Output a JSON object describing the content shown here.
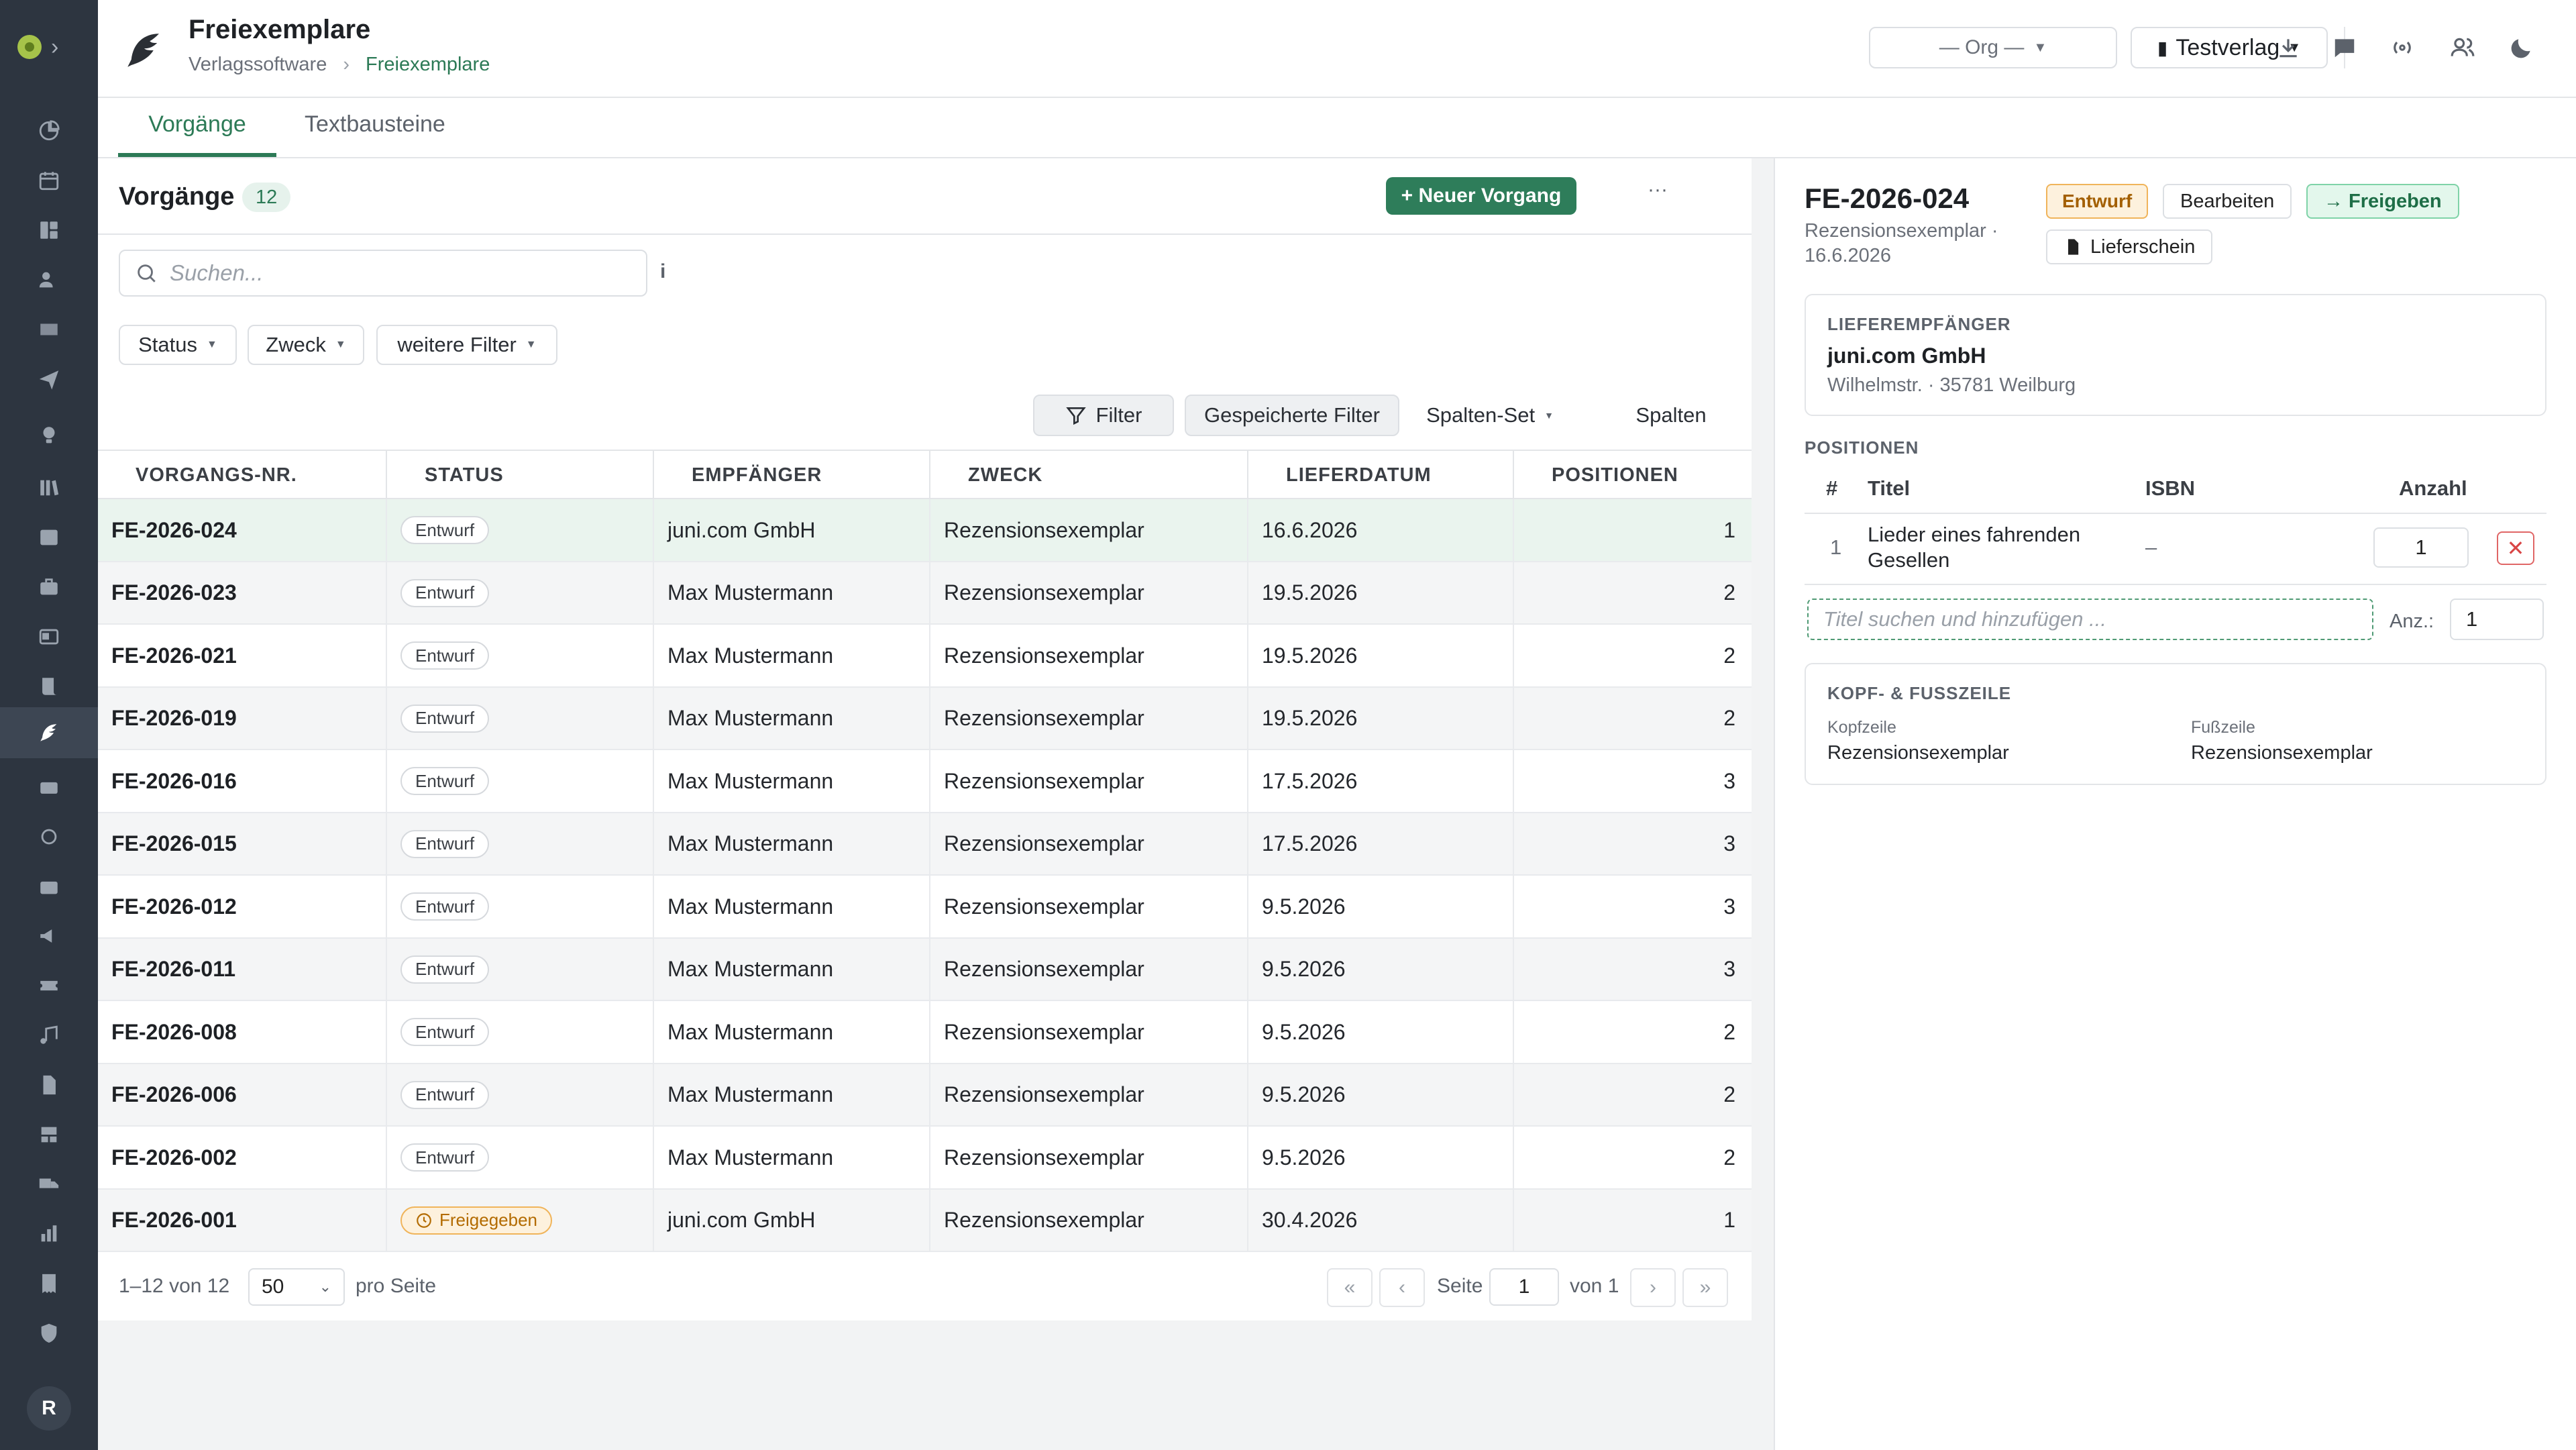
{
  "header": {
    "title": "Freiexemplare",
    "breadcrumb": [
      "Verlagssoftware",
      "Freiexemplare"
    ],
    "org_select": "— Org —",
    "verlag_select": "Testverlag"
  },
  "tabs": [
    {
      "label": "Vorgänge",
      "active": true
    },
    {
      "label": "Textbausteine",
      "active": false
    }
  ],
  "list": {
    "title": "Vorgänge",
    "count": "12",
    "new_button": "+ Neuer Vorgang",
    "more": "···",
    "search_placeholder": "Suchen...",
    "info": "i",
    "filter_chips": [
      "Status",
      "Zweck",
      "weitere Filter"
    ],
    "toolbar": {
      "filter": "Filter",
      "saved_filters": "Gespeicherte Filter",
      "column_set": "Spalten-Set",
      "columns": "Spalten"
    },
    "columns": [
      "VORGANGS-NR.",
      "STATUS",
      "EMPFÄNGER",
      "ZWECK",
      "LIEFERDATUM",
      "POSITIONEN"
    ],
    "rows": [
      {
        "id": "FE-2026-024",
        "status": "Entwurf",
        "recipient": "juni.com GmbH",
        "purpose": "Rezensionsexemplar",
        "date": "16.6.2026",
        "positions": "1"
      },
      {
        "id": "FE-2026-023",
        "status": "Entwurf",
        "recipient": "Max Mustermann",
        "purpose": "Rezensionsexemplar",
        "date": "19.5.2026",
        "positions": "2"
      },
      {
        "id": "FE-2026-021",
        "status": "Entwurf",
        "recipient": "Max Mustermann",
        "purpose": "Rezensionsexemplar",
        "date": "19.5.2026",
        "positions": "2"
      },
      {
        "id": "FE-2026-019",
        "status": "Entwurf",
        "recipient": "Max Mustermann",
        "purpose": "Rezensionsexemplar",
        "date": "19.5.2026",
        "positions": "2"
      },
      {
        "id": "FE-2026-016",
        "status": "Entwurf",
        "recipient": "Max Mustermann",
        "purpose": "Rezensionsexemplar",
        "date": "17.5.2026",
        "positions": "3"
      },
      {
        "id": "FE-2026-015",
        "status": "Entwurf",
        "recipient": "Max Mustermann",
        "purpose": "Rezensionsexemplar",
        "date": "17.5.2026",
        "positions": "3"
      },
      {
        "id": "FE-2026-012",
        "status": "Entwurf",
        "recipient": "Max Mustermann",
        "purpose": "Rezensionsexemplar",
        "date": "9.5.2026",
        "positions": "3"
      },
      {
        "id": "FE-2026-011",
        "status": "Entwurf",
        "recipient": "Max Mustermann",
        "purpose": "Rezensionsexemplar",
        "date": "9.5.2026",
        "positions": "3"
      },
      {
        "id": "FE-2026-008",
        "status": "Entwurf",
        "recipient": "Max Mustermann",
        "purpose": "Rezensionsexemplar",
        "date": "9.5.2026",
        "positions": "2"
      },
      {
        "id": "FE-2026-006",
        "status": "Entwurf",
        "recipient": "Max Mustermann",
        "purpose": "Rezensionsexemplar",
        "date": "9.5.2026",
        "positions": "2"
      },
      {
        "id": "FE-2026-002",
        "status": "Entwurf",
        "recipient": "Max Mustermann",
        "purpose": "Rezensionsexemplar",
        "date": "9.5.2026",
        "positions": "2"
      },
      {
        "id": "FE-2026-001",
        "status": "Freigegeben",
        "recipient": "juni.com GmbH",
        "purpose": "Rezensionsexemplar",
        "date": "30.4.2026",
        "positions": "1"
      }
    ],
    "footer": {
      "range": "1–12 von 12",
      "per_page": "50",
      "per_page_label": "pro Seite",
      "page_label": "Seite",
      "page": "1",
      "of_label": "von 1",
      "first": "«",
      "prev": "‹",
      "next": "›",
      "last": "»"
    }
  },
  "detail": {
    "id": "FE-2026-024",
    "subtitle": "Rezensionsexemplar · 16.6.2026",
    "badge": "Entwurf",
    "edit_button": "Bearbeiten",
    "release_button": "→ Freigeben",
    "delivery_note_button": "Lieferschein",
    "recipient_label": "LIEFEREMPFÄNGER",
    "recipient_name": "juni.com GmbH",
    "recipient_address": "Wilhelmstr. · 35781 Weilburg",
    "positions_label": "POSITIONEN",
    "positions_columns": [
      "#",
      "Titel",
      "ISBN",
      "Anzahl"
    ],
    "positions": [
      {
        "nr": "1",
        "title": "Lieder eines fahrenden Gesellen",
        "isbn": "–",
        "qty": "1"
      }
    ],
    "add_placeholder": "Titel suchen und hinzufügen ...",
    "anz_label": "Anz.:",
    "anz_value": "1",
    "header_footer_label": "KOPF- & FUSSZEILE",
    "kopfzeile_label": "Kopfzeile",
    "kopfzeile_value": "Rezensionsexemplar",
    "fusszeile_label": "Fußzeile",
    "fusszeile_value": "Rezensionsexemplar"
  },
  "rail": {
    "avatar": "R"
  },
  "colors": {
    "accent": "#2c7a56",
    "rail": "#2d3540",
    "draft_badge": "#fdf1dd"
  }
}
